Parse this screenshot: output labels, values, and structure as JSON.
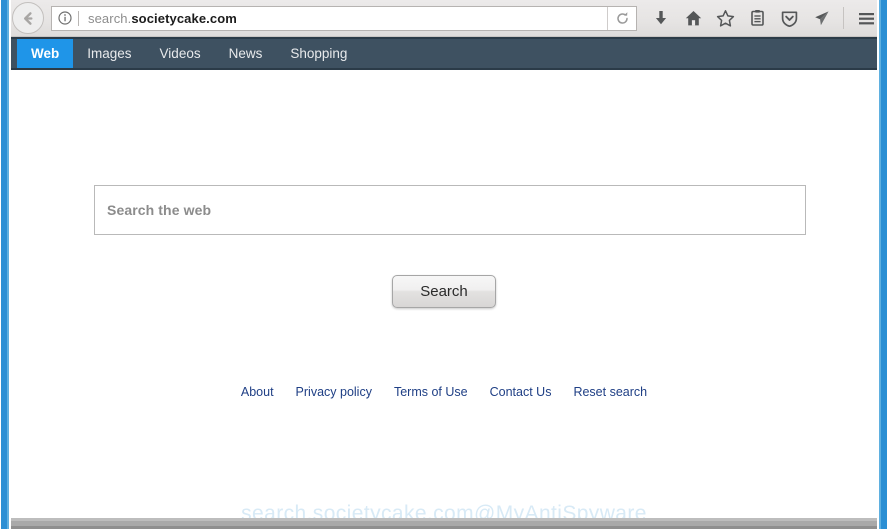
{
  "browser": {
    "back_button": "back-arrow",
    "identity_icon": "info-circle-icon",
    "url_prefix": "search.",
    "url_domain": "societycake.com",
    "url_full": "search.societycake.com",
    "reload_icon": "reload-icon",
    "toolbar_icons": [
      {
        "name": "downloads-icon",
        "label": "Downloads"
      },
      {
        "name": "home-icon",
        "label": "Home"
      },
      {
        "name": "bookmark-star-icon",
        "label": "Bookmark"
      },
      {
        "name": "library-icon",
        "label": "Library"
      },
      {
        "name": "pocket-shield-icon",
        "label": "Save to Pocket"
      },
      {
        "name": "send-tab-icon",
        "label": "Send Tab"
      },
      {
        "name": "hamburger-menu-icon",
        "label": "Open menu"
      }
    ]
  },
  "site_nav": {
    "items": [
      {
        "label": "Web",
        "active": true
      },
      {
        "label": "Images",
        "active": false
      },
      {
        "label": "Videos",
        "active": false
      },
      {
        "label": "News",
        "active": false
      },
      {
        "label": "Shopping",
        "active": false
      }
    ],
    "active_bg": "#1f95e8",
    "bar_bg": "#3e5161"
  },
  "search": {
    "placeholder": "Search the web",
    "value": "",
    "button_label": "Search"
  },
  "footer": {
    "links": [
      {
        "label": "About"
      },
      {
        "label": "Privacy policy"
      },
      {
        "label": "Terms of Use"
      },
      {
        "label": "Contact Us"
      },
      {
        "label": "Reset search"
      }
    ],
    "link_color": "#1f3f85"
  },
  "watermark": {
    "text": "search.societycake.com@MyAntiSpyware"
  }
}
